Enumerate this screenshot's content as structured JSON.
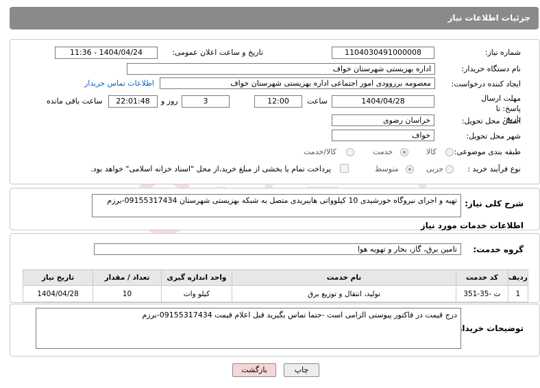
{
  "header": {
    "title": "جزئیات اطلاعات نیاز"
  },
  "form": {
    "need_number_label": "شماره نیاز:",
    "need_number": "1104030491000008",
    "announce_label": "تاریخ و ساعت اعلان عمومی:",
    "announce_value": "1404/04/24 - 11:36",
    "buyer_org_label": "نام دستگاه خریدار:",
    "buyer_org": "اداره بهزیستی شهرستان خواف",
    "creator_label": "ایجاد کننده درخواست:",
    "creator": "معصومه برروودی امور اجتماعی اداره بهزیستی شهرستان خواف",
    "contact_link": "اطلاعات تماس خریدار",
    "deadline_label": "مهلت ارسال پاسخ: تا تاریخ:",
    "deadline_date": "1404/04/28",
    "time_label": "ساعت",
    "deadline_time": "12:00",
    "days_value": "3",
    "days_label": "روز و",
    "remaining_time": "22:01:48",
    "remaining_label": "ساعت باقی مانده",
    "province_label": "استان محل تحویل:",
    "province": "خراسان رضوی",
    "city_label": "شهر محل تحویل:",
    "city": "خواف",
    "category_label": "طبقه بندی موضوعی:",
    "category_options": [
      "کالا",
      "خدمت",
      "کالا/خدمت"
    ],
    "process_label": "نوع فرآیند خرید :",
    "process_options": [
      "جزیی",
      "متوسط"
    ],
    "payment_note": "پرداخت تمام یا بخشی از مبلغ خرید،از محل \"اسناد خزانه اسلامی\" خواهد بود."
  },
  "description": {
    "label": "شرح کلی نیاز:",
    "text": "تهیه و اجرای نیروگاه خورشیدی 10 کیلوواتی  هایبریدی متصل به شبکه  بهزیستی شهرستان 09155317434-برزم"
  },
  "services": {
    "section_title": "اطلاعات خدمات مورد نیاز",
    "group_label": "گروه خدمت:",
    "group_value": "تامین برق، گاز، بخار و تهویه هوا",
    "columns": [
      "ردیف",
      "کد خدمت",
      "نام خدمت",
      "واحد اندازه گیری",
      "تعداد / مقدار",
      "تاریخ نیاز"
    ],
    "rows": [
      {
        "index": "1",
        "code": "ت -35-351",
        "name": "تولید، انتقال و توزیع برق",
        "unit": "کیلو وات",
        "qty": "10",
        "date": "1404/04/28"
      }
    ]
  },
  "buyer_notes": {
    "label": "توضیحات خریدار:",
    "text": "درج قیمت در فاکتور پیوستی الزامی است -حتما تماس بگیرید قبل اعلام قیمت 09155317434-برزم"
  },
  "buttons": {
    "print": "چاپ",
    "back": "بازگشت"
  },
  "watermark": {
    "text": "AriaTender.neT"
  },
  "colors": {
    "header_bg": "#8a8a8a",
    "link": "#0a5fc4",
    "back_button_bg": "#f5d7d7",
    "print_button_bg": "#ededed"
  }
}
